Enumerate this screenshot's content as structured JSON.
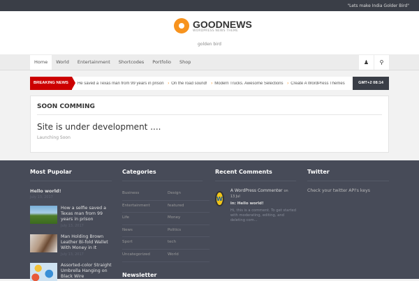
{
  "topbar": {
    "quote": "\"Lets make India Golder Bird\""
  },
  "header": {
    "logo_title": "GOODNEWS",
    "logo_sub": "WORDPRESS NEWS THEME",
    "tagline": "golden bird"
  },
  "nav": {
    "items": [
      "Home",
      "World",
      "Entertainment",
      "Shortcodes",
      "Portfolio",
      "Shop"
    ]
  },
  "breaking": {
    "label": "BREAKING NEWS",
    "items": [
      "He saved a Texas man from 99 years in prison",
      "On the road sound!",
      "Modern Trucks. Awesome Selections",
      "Create A WordPress Themes"
    ],
    "time": "GMT+2 08:14"
  },
  "content": {
    "heading": "SOON COMMING",
    "title": "Site is under development ....",
    "subtitle": "Launching Soon"
  },
  "footer": {
    "popular": {
      "title": "Most Pupolar",
      "first": "Hello world!",
      "first_date": "July 13, 2017",
      "posts": [
        {
          "title": "How a selfie saved a Texas man from 99 years in prison",
          "date": "July 13, 2017"
        },
        {
          "title": "Man Holding Brown Leather Bi-fold Wallet With Money in It",
          "date": "July 13, 2017"
        },
        {
          "title": "Assorted-color Straight Umbrella Hanging on Black Wire"
        }
      ]
    },
    "categories": {
      "title": "Categories",
      "items": [
        "Business",
        "Design",
        "Entertainment",
        "featured",
        "Life",
        "Money",
        "News",
        "Politics",
        "Sport",
        "tech",
        "Uncategorized",
        "World"
      ]
    },
    "newsletter": {
      "title": "Newsletter"
    },
    "comments": {
      "title": "Recent Comments",
      "author": "A WordPress Commenter",
      "on": "on",
      "date": "13 Jul",
      "in_label": "in:",
      "post": "Hello world!",
      "excerpt": "Hi, this is a comment. To get started with moderating, editing, and deleting com..."
    },
    "twitter": {
      "title": "Twitter",
      "text": "Check your twitter API's keys"
    }
  }
}
